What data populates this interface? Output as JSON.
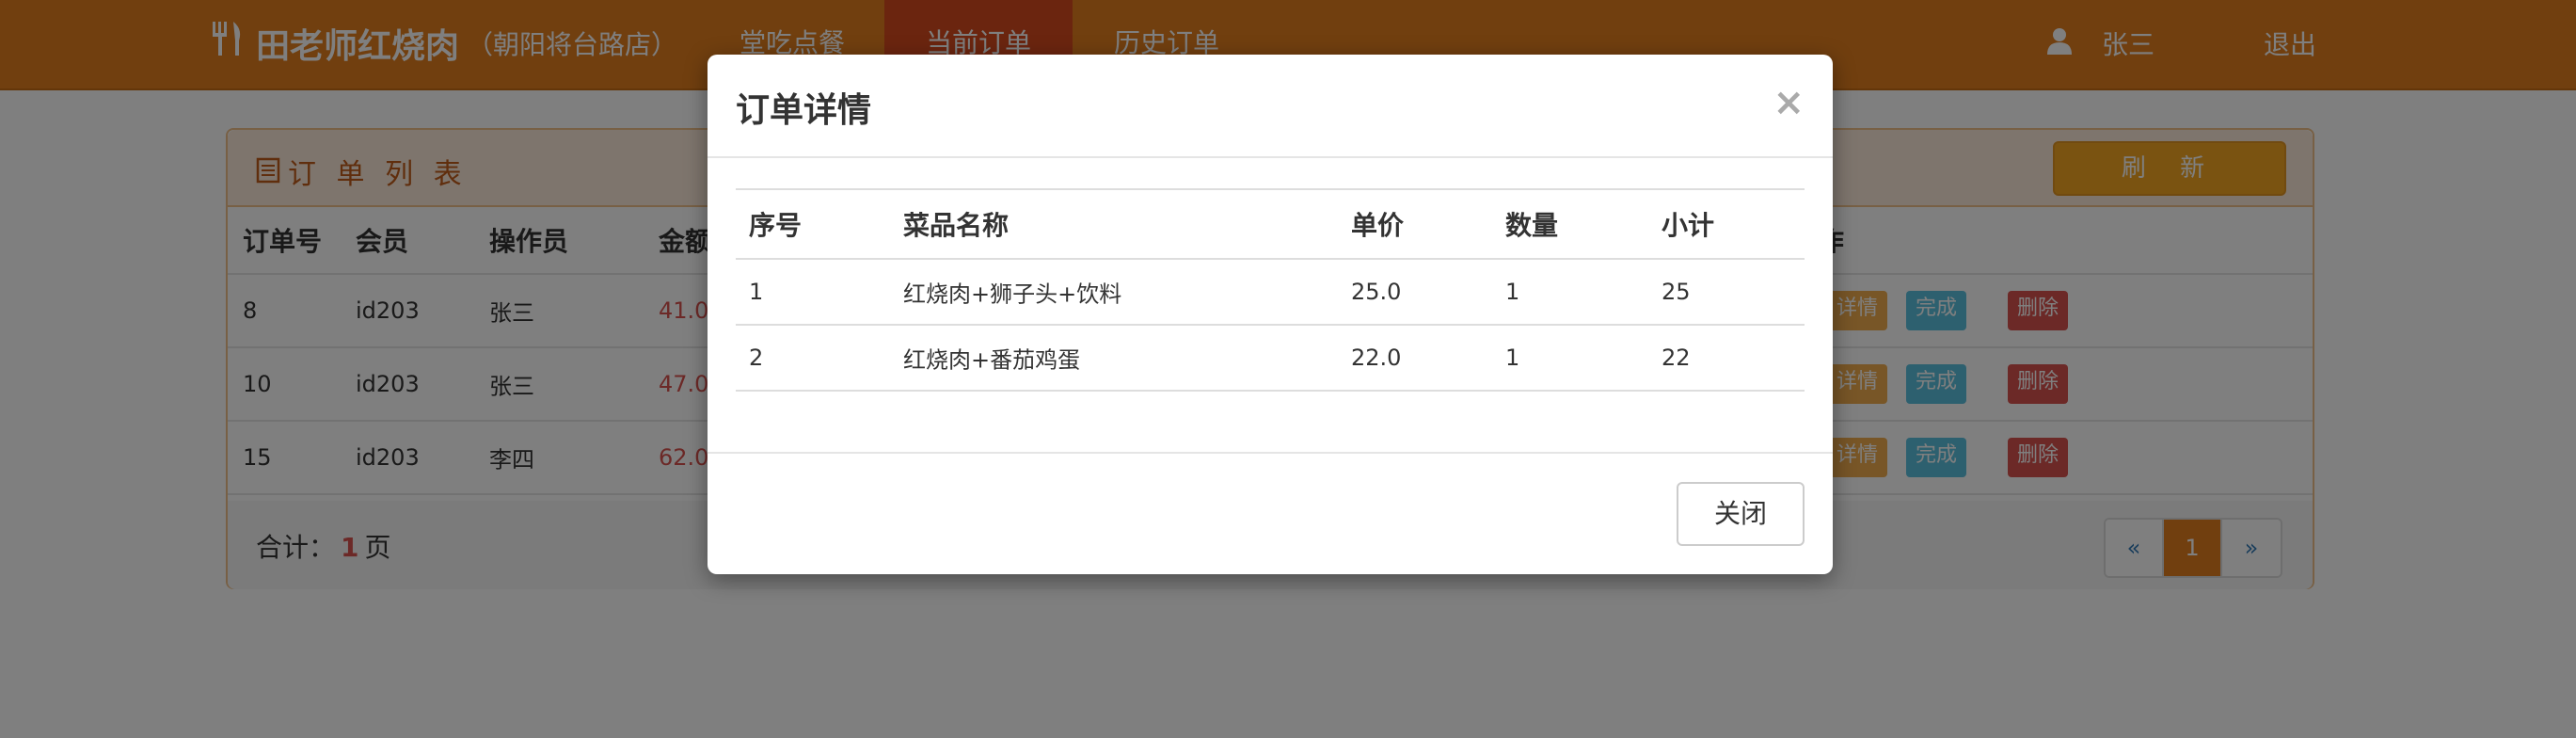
{
  "app": {
    "brand": "田老师红烧肉",
    "branch": "（朝阳将台路店）",
    "nav": [
      "堂吃点餐",
      "当前订单",
      "历史订单"
    ],
    "user": "张三",
    "logout": "退出"
  },
  "panel": {
    "title": "订 单 列 表",
    "refresh": "刷 新",
    "columns": [
      "订单号",
      "会员",
      "操作员",
      "金额",
      "作"
    ],
    "orders": [
      {
        "id": "8",
        "member": "id203",
        "operator": "张三",
        "amount": "41.0"
      },
      {
        "id": "10",
        "member": "id203",
        "operator": "张三",
        "amount": "47.0"
      },
      {
        "id": "15",
        "member": "id203",
        "operator": "李四",
        "amount": "62.0"
      }
    ],
    "actions": {
      "detail": "详情",
      "done": "完成",
      "delete": "删除"
    },
    "footer": {
      "prefix": "合计：",
      "pages": "1",
      "suffix": "页"
    },
    "pager": {
      "prev": "«",
      "current": "1",
      "next": "»"
    }
  },
  "modal": {
    "title": "订单详情",
    "close_icon": "×",
    "columns": [
      "序号",
      "菜品名称",
      "单价",
      "数量",
      "小计"
    ],
    "items": [
      {
        "no": "1",
        "dish": "红烧肉+狮子头+饮料",
        "price": "25.0",
        "qty": "1",
        "subtotal": "25"
      },
      {
        "no": "2",
        "dish": "红烧肉+番茄鸡蛋",
        "price": "22.0",
        "qty": "1",
        "subtotal": "22"
      }
    ],
    "close_button": "关闭"
  },
  "colors": {
    "navbar": "#e27f1f",
    "nav_active": "#d64a1e",
    "amount": "#d9534f"
  }
}
